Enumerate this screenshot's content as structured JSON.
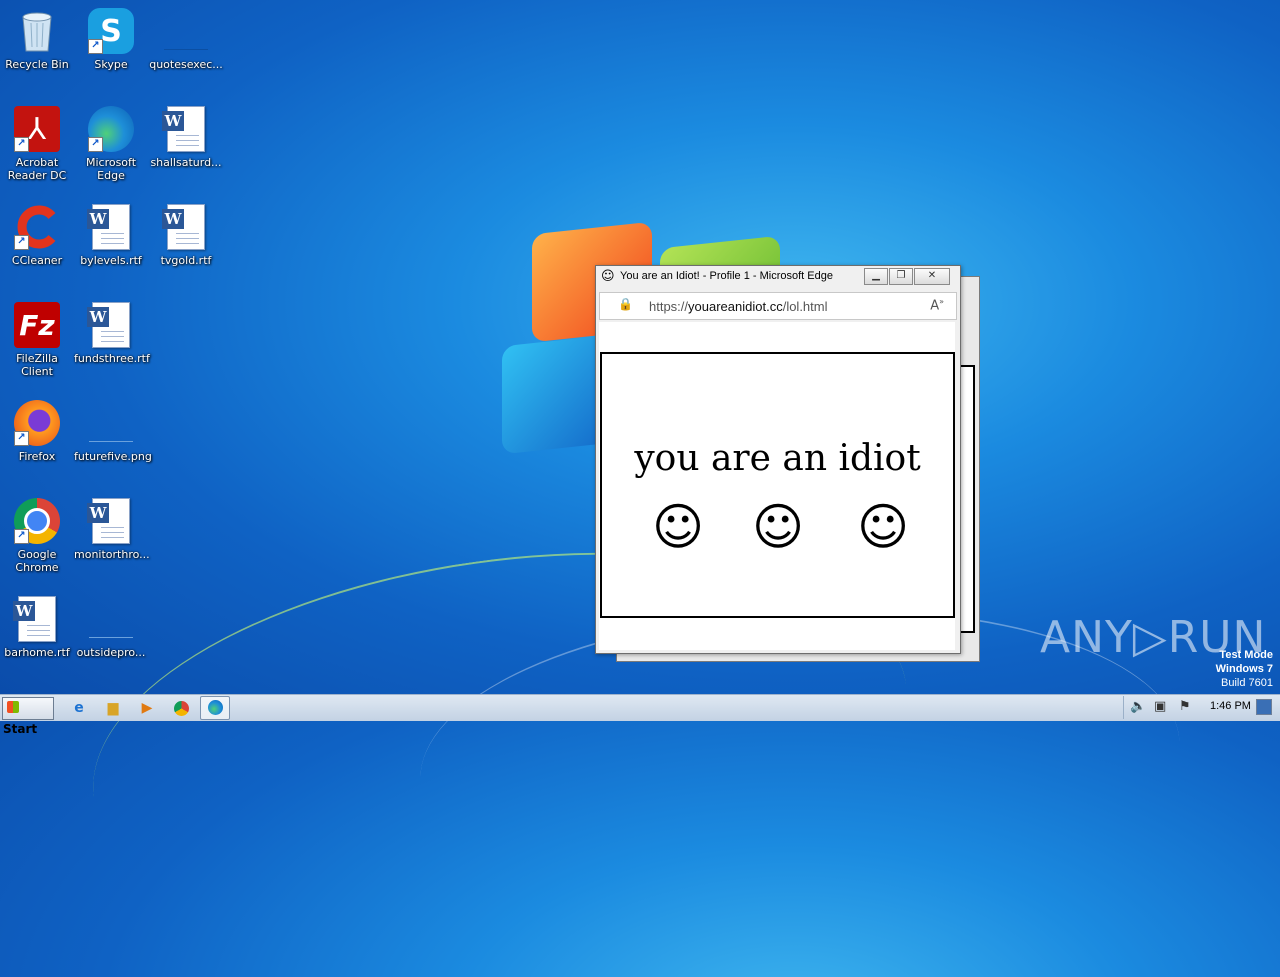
{
  "desktop": {
    "icons": [
      {
        "label": "Recycle Bin",
        "icon": "recycle-bin-icon"
      },
      {
        "label": "Skype",
        "icon": "skype-icon"
      },
      {
        "label": "quotesexec...",
        "icon": "blank-file-icon"
      },
      {
        "label": "Acrobat Reader DC",
        "icon": "acrobat-icon"
      },
      {
        "label": "Microsoft Edge",
        "icon": "edge-icon"
      },
      {
        "label": "shallsaturd...",
        "icon": "word-doc-icon"
      },
      {
        "label": "CCleaner",
        "icon": "ccleaner-icon"
      },
      {
        "label": "bylevels.rtf",
        "icon": "word-doc-icon"
      },
      {
        "label": "tvgold.rtf",
        "icon": "word-doc-icon"
      },
      {
        "label": "FileZilla Client",
        "icon": "filezilla-icon"
      },
      {
        "label": "fundsthree.rtf",
        "icon": "word-doc-icon"
      },
      {
        "label": "Firefox",
        "icon": "firefox-icon"
      },
      {
        "label": "futurefive.png",
        "icon": "blank-file-icon"
      },
      {
        "label": "Google Chrome",
        "icon": "chrome-icon"
      },
      {
        "label": "monitorthro...",
        "icon": "word-doc-icon"
      },
      {
        "label": "barhome.rtf",
        "icon": "word-doc-icon"
      },
      {
        "label": "outsidepro...",
        "icon": "blank-file-icon"
      }
    ]
  },
  "window": {
    "title": "You are an Idiot! - Profile 1 - Microsoft Edge",
    "url_prefix": "https://",
    "url_domain": "youareanidiot.cc",
    "url_path": "/lol.html",
    "headline": "you are an idiot",
    "smileys": [
      "☺",
      "☺",
      "☺"
    ]
  },
  "watermark": "ANY▷RUN",
  "system": {
    "test_mode": "Test Mode",
    "os": "Windows 7",
    "build": "Build 7601"
  },
  "taskbar": {
    "start_label": "Start",
    "clock": "1:46 PM"
  }
}
